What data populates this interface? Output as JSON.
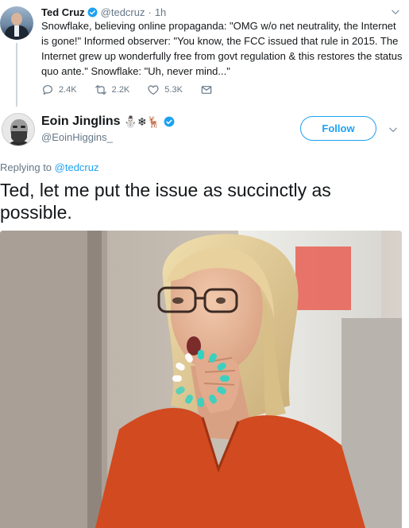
{
  "parent_tweet": {
    "name": "Ted Cruz",
    "handle": "@tedcruz",
    "separator": "·",
    "time": "1h",
    "text": "Snowflake, believing online propaganda: \"OMG w/o net neutrality, the Internet is gone!\" Informed observer: \"You know, the FCC issued that rule in 2015. The Internet grew up wonderfully free from govt regulation & this restores the status quo ante.\"  Snowflake: \"Uh, never mind...\"",
    "replies": "2.4K",
    "retweets": "2.2K",
    "likes": "5.3K"
  },
  "tweet": {
    "name": "Eoin Jinglins",
    "emojis": "⛄❄🦌",
    "handle": "@EoinHiggins_",
    "follow_label": "Follow",
    "replying_prefix": "Replying to ",
    "replying_to": "@tedcruz",
    "text": "Ted, let me put the issue as succinctly as possible."
  },
  "colors": {
    "accent": "#1da1f2",
    "secondary_text": "#657786",
    "spinner": "#2fd3c4"
  },
  "icons": [
    "verified-badge-icon",
    "chevron-down-icon",
    "reply-icon",
    "retweet-icon",
    "like-icon",
    "message-icon",
    "loading-spinner-icon"
  ]
}
